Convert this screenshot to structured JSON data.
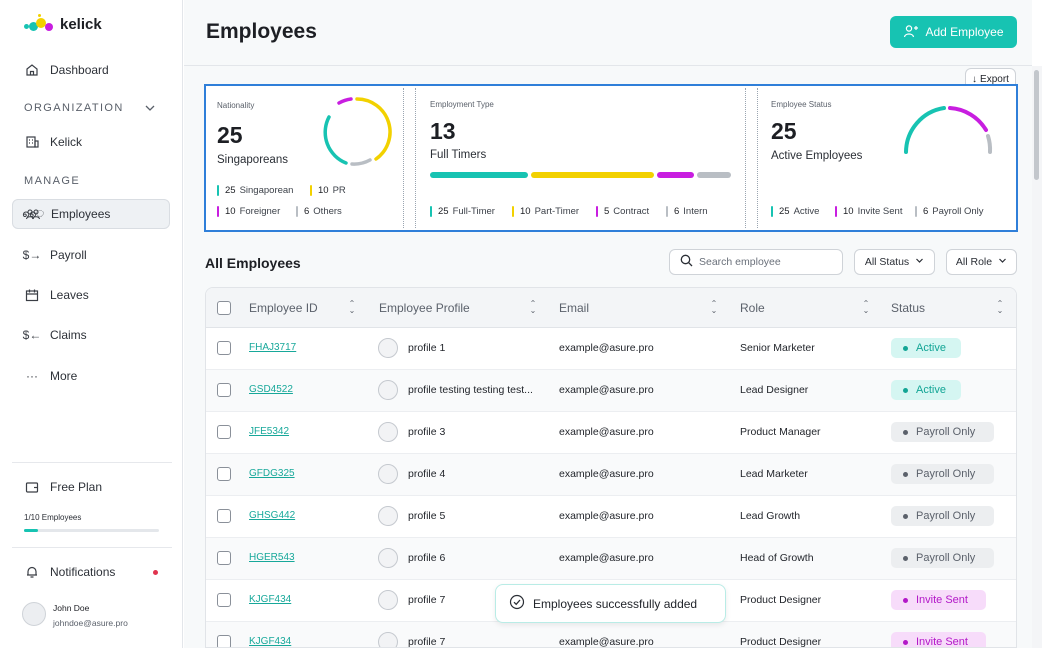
{
  "app": {
    "name": "kelick"
  },
  "sidebar": {
    "dashboard": "Dashboard",
    "organization_label": "ORGANIZATION",
    "org_item": "Kelick",
    "manage_label": "MANAGE",
    "items": [
      {
        "label": "Employees",
        "icon": "users-icon",
        "active": true
      },
      {
        "label": "Payroll",
        "icon": "payroll-icon"
      },
      {
        "label": "Leaves",
        "icon": "calendar-icon"
      },
      {
        "label": "Claims",
        "icon": "claims-icon"
      },
      {
        "label": "More",
        "icon": "more-icon"
      }
    ],
    "plan": {
      "label": "Free Plan",
      "usage": "1/10 Employees",
      "usage_fraction": 0.1
    },
    "notifications": "Notifications",
    "user": {
      "name": "John Doe",
      "email": "johndoe@asure.pro"
    }
  },
  "header": {
    "title": "Employees",
    "add_button": "Add Employee",
    "export_button": "Export"
  },
  "stats": {
    "nationality": {
      "title": "Nationality",
      "value": "25",
      "label": "Singaporeans",
      "legend": [
        {
          "count": "25",
          "label": "Singaporean",
          "color": "#17c3b2"
        },
        {
          "count": "10",
          "label": "PR",
          "color": "#f2d100"
        },
        {
          "count": "10",
          "label": "Foreigner",
          "color": "#c81ee0"
        },
        {
          "count": "6",
          "label": "Others",
          "color": "#b9bec4"
        }
      ]
    },
    "employment": {
      "title": "Employment Type",
      "value": "13",
      "label": "Full Timers",
      "legend": [
        {
          "count": "25",
          "label": "Full-Timer",
          "color": "#17c3b2"
        },
        {
          "count": "10",
          "label": "Part-Timer",
          "color": "#f2d100"
        },
        {
          "count": "5",
          "label": "Contract",
          "color": "#c81ee0"
        },
        {
          "count": "6",
          "label": "Intern",
          "color": "#b9bec4"
        }
      ]
    },
    "status": {
      "title": "Employee Status",
      "value": "25",
      "label": "Active Employees",
      "legend": [
        {
          "count": "25",
          "label": "Active",
          "color": "#17c3b2"
        },
        {
          "count": "10",
          "label": "Invite Sent",
          "color": "#c81ee0"
        },
        {
          "count": "6",
          "label": "Payroll Only",
          "color": "#b9bec4"
        }
      ]
    }
  },
  "list": {
    "title": "All Employees",
    "search_placeholder": "Search employee",
    "status_filter": "All Status",
    "role_filter": "All Role",
    "columns": [
      "Employee ID",
      "Employee Profile",
      "Email",
      "Role",
      "Status"
    ],
    "rows": [
      {
        "id": "FHAJ3717",
        "profile": "profile 1",
        "email": "example@asure.pro",
        "role": "Senior Marketer",
        "status": "Active"
      },
      {
        "id": "GSD4522",
        "profile": "profile testing testing test...",
        "email": "example@asure.pro",
        "role": "Lead Designer",
        "status": "Active"
      },
      {
        "id": "JFE5342",
        "profile": "profile 3",
        "email": "example@asure.pro",
        "role": "Product Manager",
        "status": "Payroll Only"
      },
      {
        "id": "GFDG325",
        "profile": "profile 4",
        "email": "example@asure.pro",
        "role": "Lead Marketer",
        "status": "Payroll Only"
      },
      {
        "id": "GHSG442",
        "profile": "profile 5",
        "email": "example@asure.pro",
        "role": "Lead Growth",
        "status": "Payroll Only"
      },
      {
        "id": "HGER543",
        "profile": "profile 6",
        "email": "example@asure.pro",
        "role": "Head of Growth",
        "status": "Payroll Only"
      },
      {
        "id": "KJGF434",
        "profile": "profile 7",
        "email": "example@asure.pro",
        "role": "Product Designer",
        "status": "Invite Sent"
      },
      {
        "id": "KJGF434",
        "profile": "profile 7",
        "email": "example@asure.pro",
        "role": "Product Designer",
        "status": "Invite Sent"
      }
    ]
  },
  "toast": {
    "message": "Employees successfully added"
  },
  "colors": {
    "accent": "#17c3b2",
    "yellow": "#f2d100",
    "magenta": "#c81ee0",
    "grey": "#b9bec4"
  }
}
